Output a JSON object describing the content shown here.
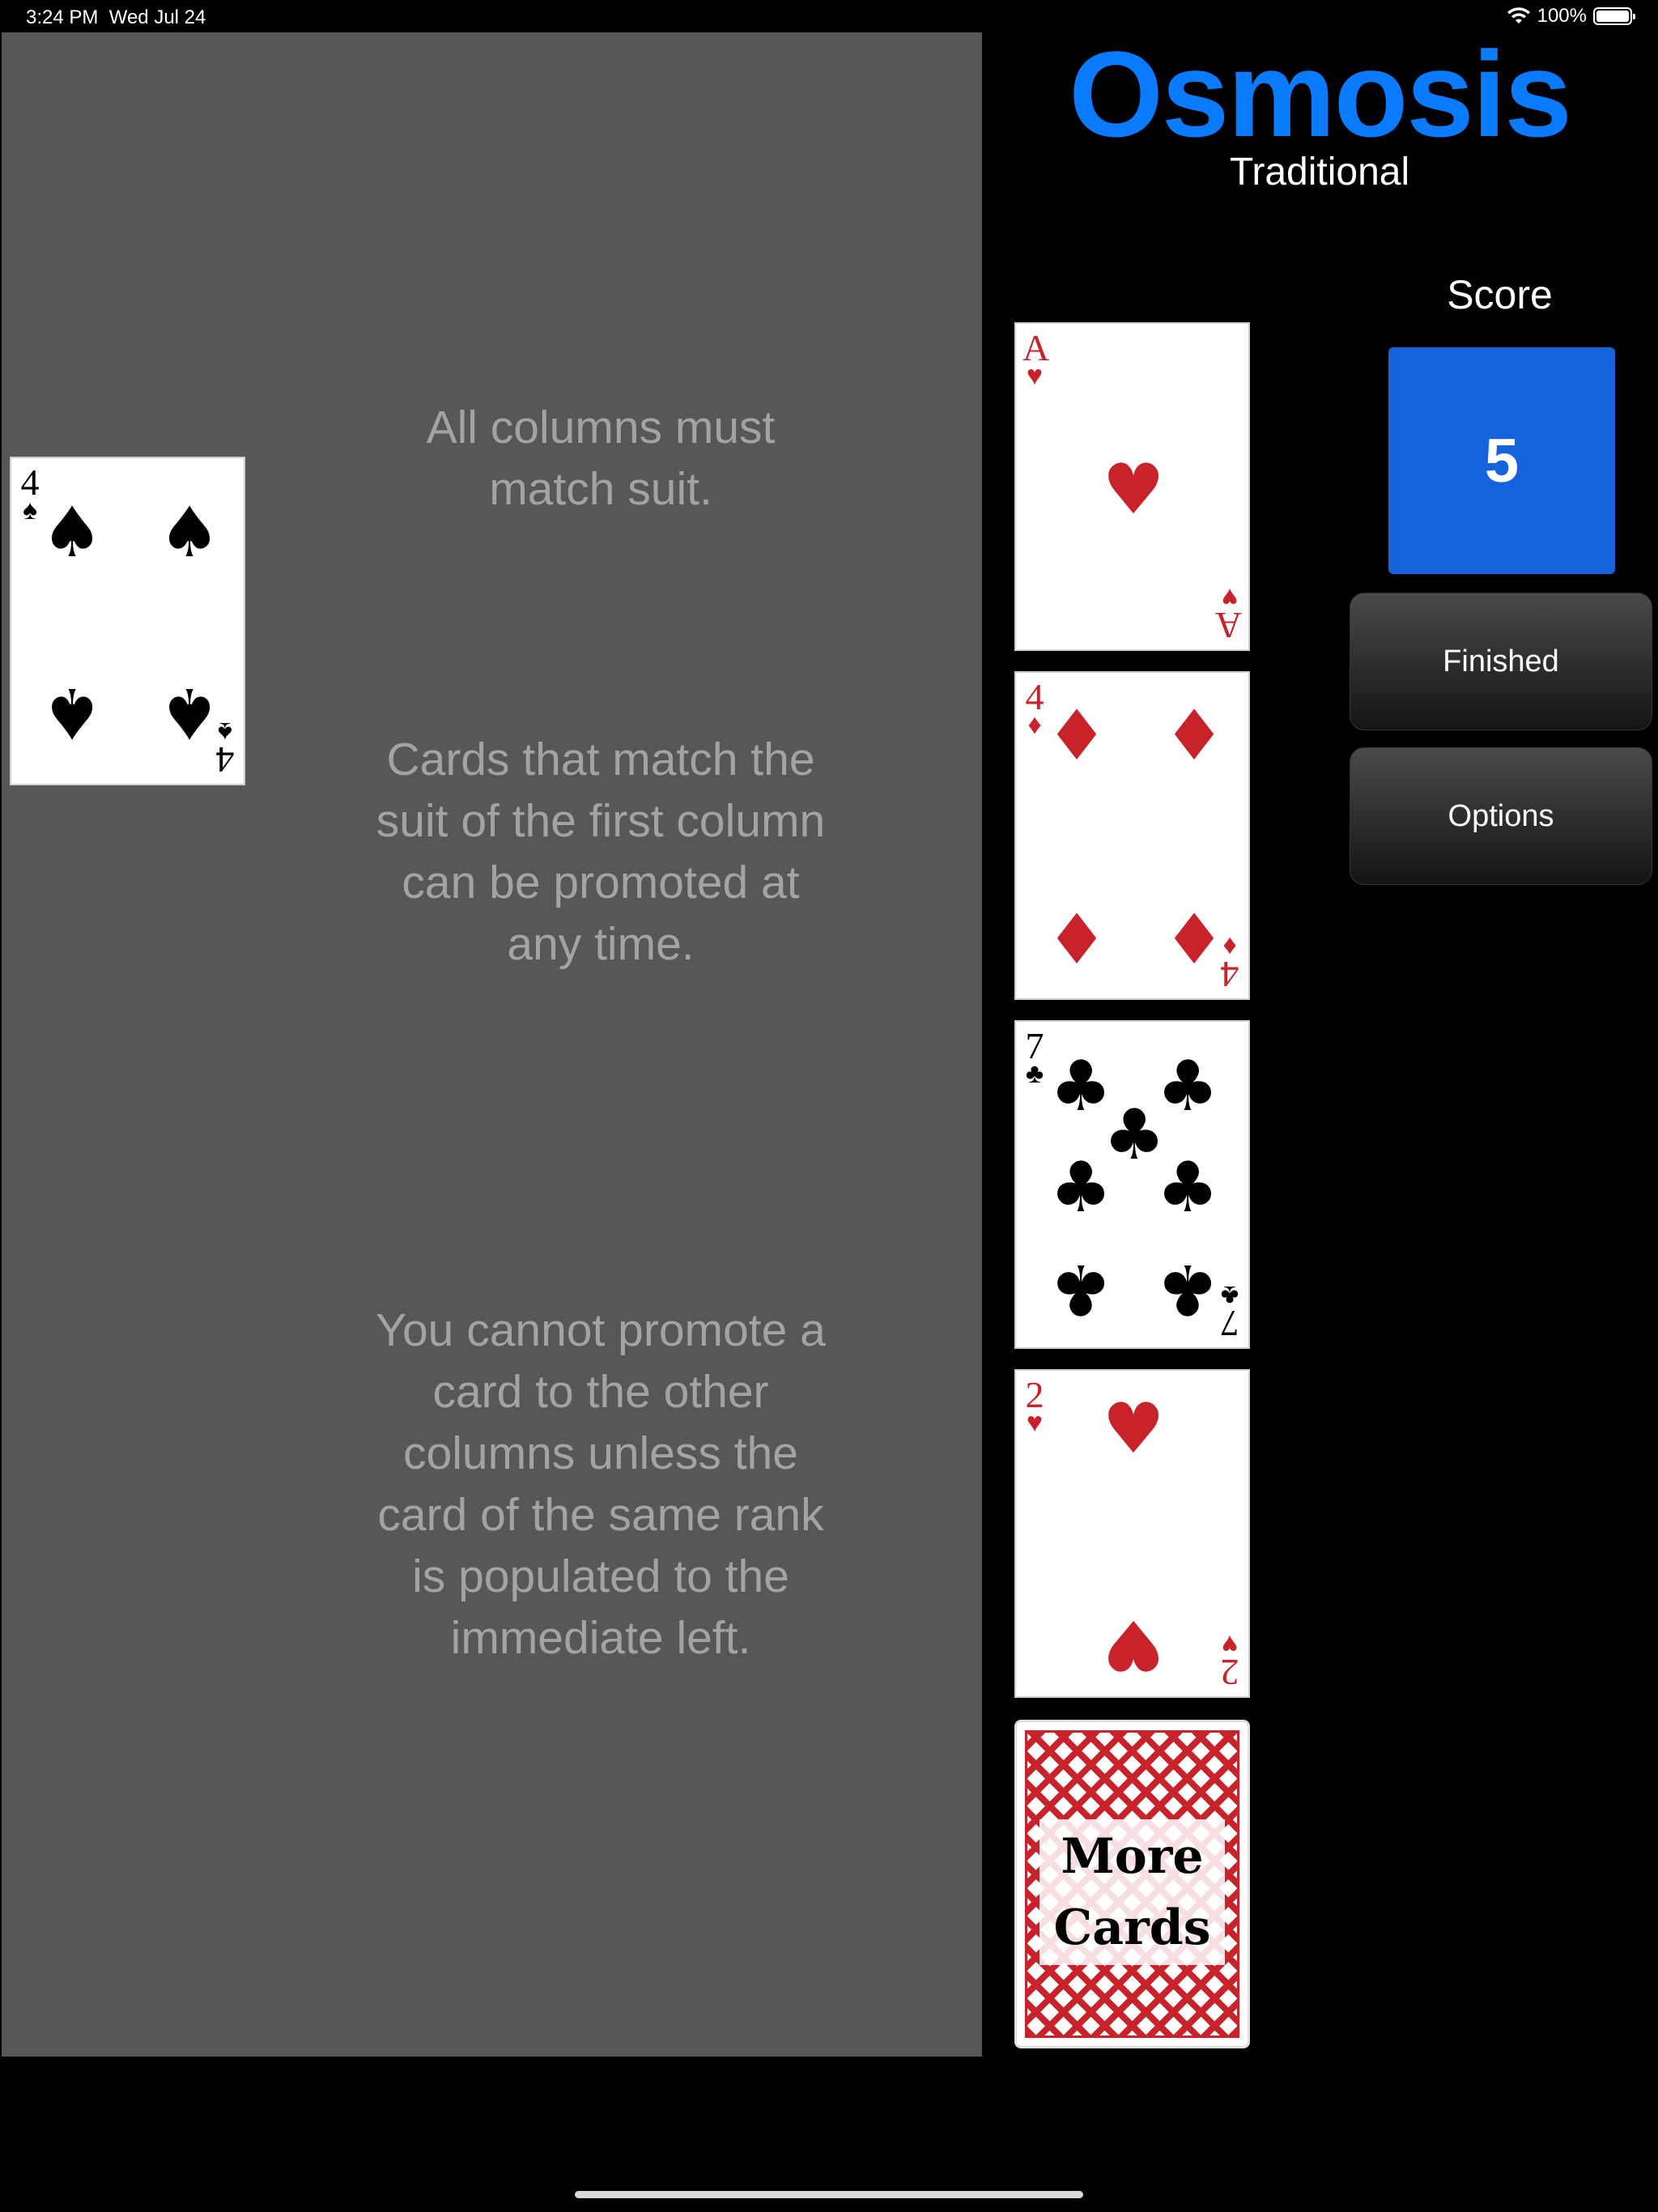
{
  "status_bar": {
    "time": "3:24 PM",
    "date": "Wed Jul 24",
    "battery": "100%",
    "battery_level": 1.0
  },
  "game": {
    "title": "Osmosis",
    "variant": "Traditional"
  },
  "score": {
    "label": "Score",
    "value": "5"
  },
  "buttons": {
    "finished": "Finished",
    "options": "Options"
  },
  "hints": [
    "All columns must match suit.",
    "Cards that match the suit of the first column can be promoted at any time.",
    "You cannot promote a card to the other columns unless the card of the same rank is populated to the immediate left."
  ],
  "board_cards": [
    {
      "rank": "4",
      "suit": "♠",
      "color": "black"
    }
  ],
  "reserve_cards": [
    {
      "rank": "A",
      "suit": "♥",
      "color": "red"
    },
    {
      "rank": "4",
      "suit": "♦",
      "color": "red"
    },
    {
      "rank": "7",
      "suit": "♣",
      "color": "black"
    },
    {
      "rank": "2",
      "suit": "♥",
      "color": "red"
    }
  ],
  "deck": {
    "line1": "More",
    "line2": "Cards"
  },
  "colors": {
    "title_blue": "#0a7bff",
    "score_bg": "#1463dc",
    "board_bg": "#575757",
    "card_red": "#c8222a"
  }
}
